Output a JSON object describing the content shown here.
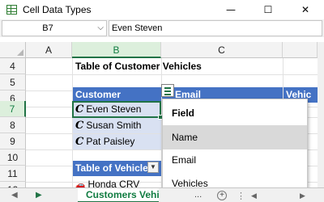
{
  "window": {
    "title": "Cell Data Types",
    "minimize_icon": "minimize-icon",
    "maximize_icon": "maximize-icon",
    "close_icon": "close-icon",
    "minimize_glyph": "—",
    "maximize_glyph": "☐",
    "close_glyph": "✕"
  },
  "formula_bar": {
    "name_box": "B7",
    "name_box_arrow": "⌵",
    "formula": "Even Steven"
  },
  "columns": [
    "A",
    "B",
    "C"
  ],
  "rows": [
    "4",
    "5",
    "6",
    "7",
    "8",
    "9",
    "10",
    "11",
    "12"
  ],
  "cells": {
    "b4": "Table of Customer Vehicles",
    "b6": "Customer",
    "c6": "Email",
    "d6": "Vehic",
    "b7": "Even Steven",
    "b8": "Susan Smith",
    "b9": "Pat Paisley",
    "b11": "Table of Vehicle",
    "b12": "Honda CRV",
    "linked_type_glyph": "C",
    "car_glyph": "🚗",
    "filter_glyph": "▼"
  },
  "dropdown": {
    "header": "Field",
    "items": [
      "Name",
      "Email",
      "Vehicles"
    ]
  },
  "sheet_tabs": {
    "active": "Customers Vehicles",
    "more": "...",
    "add_glyph": "+",
    "sep_glyph": "⋮",
    "nav_left": "◀",
    "nav_right": "▶",
    "scroll_left": "◀",
    "scroll_right": "▶"
  },
  "colors": {
    "accent": "#217346",
    "table_header": "#4472c4",
    "table_row": "#d9e1f2"
  }
}
